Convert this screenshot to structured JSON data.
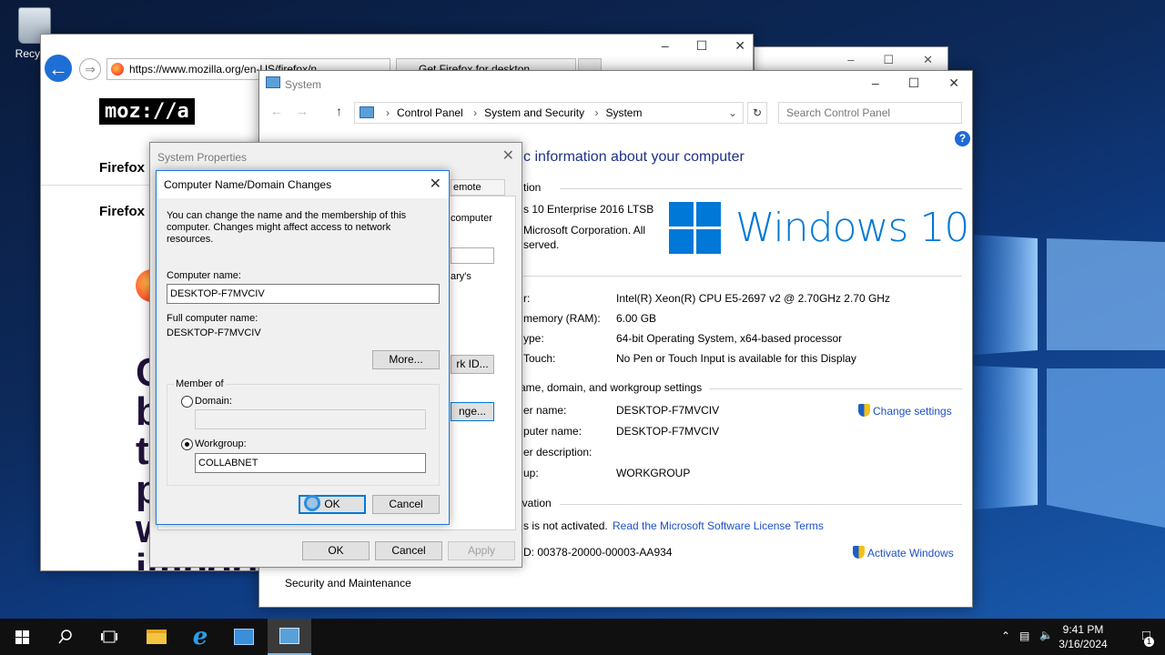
{
  "desktop": {
    "recycle_label": "Recycle"
  },
  "browser": {
    "url": "https://www.mozilla.org/en-US/firefox/n",
    "tab_title": "Get Firefox for deskton",
    "logo_text": "moz://a",
    "link1": "Firefox",
    "link2": "Firefox",
    "hero_letters": [
      "C",
      "b",
      "t",
      "p",
      "w",
      "import"
    ]
  },
  "system": {
    "window_title": "System",
    "breadcrumb": [
      "Control Panel",
      "System and Security",
      "System"
    ],
    "search_placeholder": "Search Control Panel",
    "heading": "c information about your computer",
    "edition_header": "tion",
    "edition": "s 10 Enterprise 2016 LTSB",
    "copyright1": "Microsoft Corporation. All",
    "copyright2": "served.",
    "windows_logo_text": "Windows 10",
    "specs": [
      {
        "label": "r:",
        "value": "Intel(R) Xeon(R) CPU E5-2697 v2 @ 2.70GHz   2.70 GHz"
      },
      {
        "label": "memory (RAM):",
        "value": "6.00 GB"
      },
      {
        "label": "ype:",
        "value": "64-bit Operating System, x64-based processor"
      },
      {
        "label": "Touch:",
        "value": "No Pen or Touch Input is available for this Display"
      }
    ],
    "name_section_header": "ame, domain, and workgroup settings",
    "name_rows": [
      {
        "label": "er name:",
        "value": "DESKTOP-F7MVCIV"
      },
      {
        "label": "puter name:",
        "value": "DESKTOP-F7MVCIV"
      },
      {
        "label": "er description:",
        "value": ""
      },
      {
        "label": "up:",
        "value": "WORKGROUP"
      }
    ],
    "change_settings": "Change settings",
    "activation_header": "ivation",
    "activation_status": "s is not activated.",
    "license_link": "Read the Microsoft Software License Terms",
    "product_id": "D:  00378-20000-00003-AA934",
    "activate_link": "Activate Windows",
    "footer_link": "Security and Maintenance"
  },
  "sysprops": {
    "title": "System Properties",
    "tab_remote": "emote",
    "partial1": "computer",
    "partial2": "ary's",
    "network_id_btn": "rk ID...",
    "change_btn": "nge...",
    "ok": "OK",
    "cancel": "Cancel",
    "apply": "Apply"
  },
  "dialog": {
    "title": "Computer Name/Domain Changes",
    "description": "You can change the name and the membership of this computer. Changes might affect access to network resources.",
    "computer_name_label": "Computer name:",
    "computer_name_value": "DESKTOP-F7MVCIV",
    "full_name_label": "Full computer name:",
    "full_name_value": "DESKTOP-F7MVCIV",
    "more_btn": "More...",
    "member_of": "Member of",
    "domain_label": "Domain:",
    "domain_value": "",
    "workgroup_label": "Workgroup:",
    "workgroup_value": "COLLABNET",
    "selected": "workgroup",
    "ok": "OK",
    "cancel": "Cancel"
  },
  "taskbar": {
    "apps": [
      "start-icon",
      "search-icon",
      "task-view-icon",
      "file-explorer-icon",
      "internet-explorer-icon",
      "server-manager-icon",
      "system-properties-icon"
    ],
    "time": "9:41 PM",
    "date": "3/16/2024",
    "notification_count": "1"
  },
  "colors": {
    "accent": "#0078d7",
    "link": "#1e50c8",
    "taskbar": "#101010"
  }
}
